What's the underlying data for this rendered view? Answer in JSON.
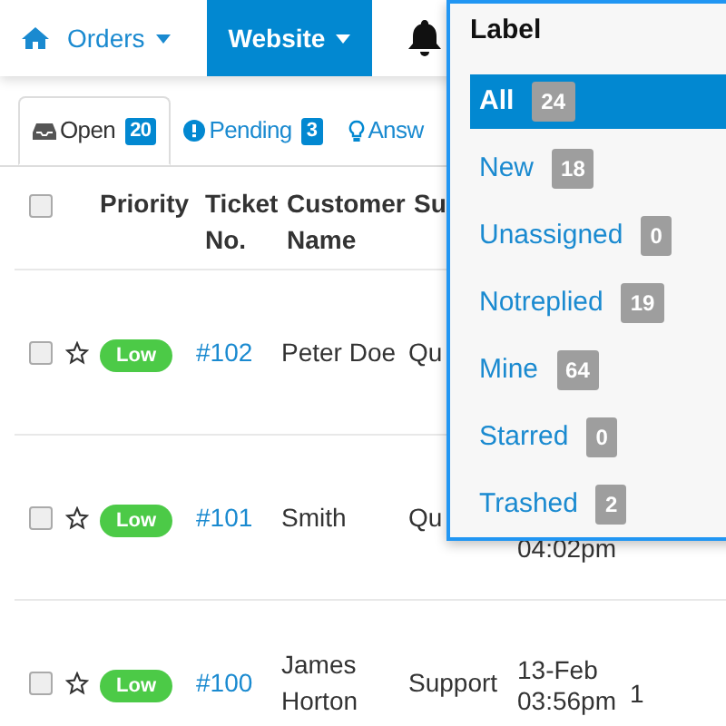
{
  "navbar": {
    "items": [
      {
        "label": "Orders",
        "selected": false
      },
      {
        "label": "Website",
        "selected": true
      }
    ]
  },
  "tabs": [
    {
      "label": "Open",
      "count": "20",
      "kind": "inbox",
      "selected": true
    },
    {
      "label": "Pending",
      "count": "3",
      "kind": "alert",
      "selected": false
    },
    {
      "label": "Answ",
      "kind": "bulb",
      "selected": false
    }
  ],
  "table": {
    "all_checked": false,
    "columns": [
      "Priority",
      "Ticket No.",
      "Customer Name",
      "Su"
    ],
    "rows": [
      {
        "checked": false,
        "starred": false,
        "priority": "Low",
        "ticket": "#102",
        "customer": "Peter Doe",
        "subject": "Qu",
        "date": []
      },
      {
        "checked": false,
        "starred": false,
        "priority": "Low",
        "ticket": "#101",
        "customer": "Smith",
        "subject": "Qu",
        "date": [
          "04:02pm"
        ]
      },
      {
        "checked": false,
        "starred": false,
        "priority": "Low",
        "ticket": "#100",
        "customer": "James Horton",
        "subject": "Support",
        "date": [
          "13-Feb",
          "03:56pm"
        ],
        "column_8": "1"
      }
    ]
  },
  "label_menu": {
    "title": "Label",
    "items": [
      {
        "label": "All",
        "count": "24",
        "selected": true
      },
      {
        "label": "New",
        "count": "18",
        "selected": false
      },
      {
        "label": "Unassigned",
        "count": "0",
        "selected": false
      },
      {
        "label": "Notreplied",
        "count": "19",
        "selected": false
      },
      {
        "label": "Mine",
        "count": "64",
        "selected": false
      },
      {
        "label": "Starred",
        "count": "0",
        "selected": false
      },
      {
        "label": "Trashed",
        "count": "2",
        "selected": false
      }
    ]
  }
}
